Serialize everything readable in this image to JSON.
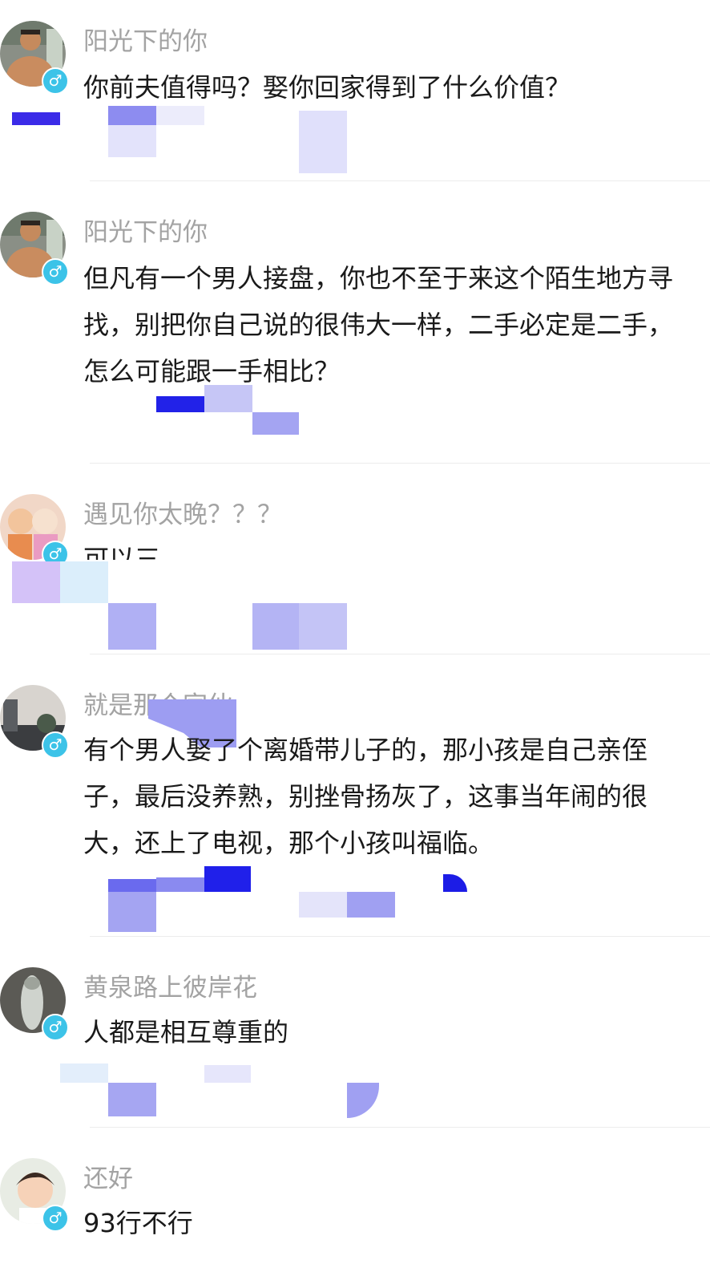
{
  "gender_symbol": "♂",
  "comments": [
    {
      "name": "阳光下的你",
      "text": "你前夫值得吗？娶你回家得到了什么价值？",
      "avatar_icon": "muscular-man-avatar"
    },
    {
      "name": "阳光下的你",
      "text": "但凡有一个男人接盘，你也不至于来这个陌生地方寻找，别把你自己说的很伟大一样，二手必定是二手，怎么可能跟一手相比？",
      "avatar_icon": "muscular-man-avatar"
    },
    {
      "name": "遇见你太晚？？？",
      "text": "可以三",
      "avatar_icon": "cartoon-cats-avatar"
    },
    {
      "name": "就是那个家伙",
      "text": "有个男人娶了个离婚带儿子的，那小孩是自己亲侄子，最后没养熟，别挫骨扬灰了，这事当年闹的很大，还上了电视，那个小孩叫福临。",
      "avatar_icon": "city-sunset-avatar"
    },
    {
      "name": "黄泉路上彼岸花",
      "text": "人都是相互尊重的",
      "avatar_icon": "fish-avatar"
    },
    {
      "name": "还好",
      "text": "93行不行",
      "avatar_icon": "cartoon-boy-avatar"
    }
  ],
  "colors": {
    "name": "#a3a3a3",
    "text": "#1a1a1a",
    "badge": "#3cc3e8",
    "divider": "#ececec"
  }
}
